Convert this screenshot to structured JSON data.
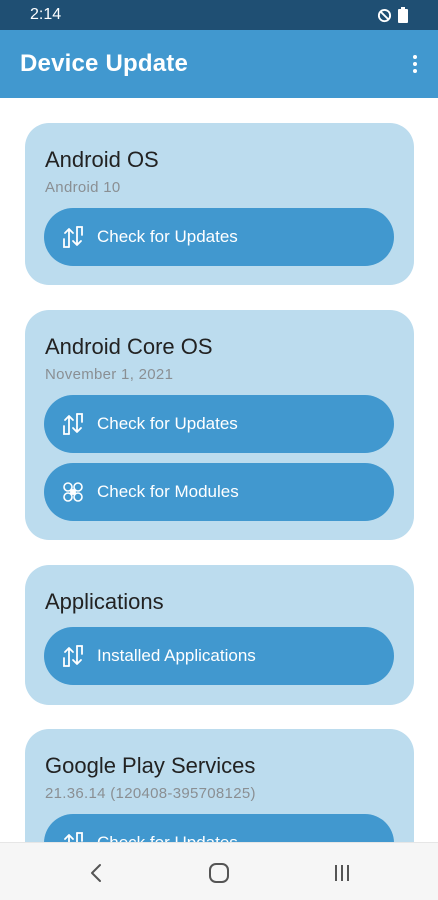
{
  "status_bar": {
    "time": "2:14",
    "icons": [
      "do-not-disturb-icon",
      "battery-icon"
    ]
  },
  "app_bar": {
    "title": "Device Update",
    "menu_icon": "more-vert-icon"
  },
  "cards": [
    {
      "title": "Android OS",
      "subtitle": "Android 10",
      "buttons": [
        {
          "label": "Check for Updates",
          "icon": "sync-arrows-icon"
        }
      ]
    },
    {
      "title": "Android Core OS",
      "subtitle": "November 1, 2021",
      "buttons": [
        {
          "label": "Check for Updates",
          "icon": "sync-arrows-icon"
        },
        {
          "label": "Check for Modules",
          "icon": "modules-icon"
        }
      ]
    },
    {
      "title": "Applications",
      "subtitle": "",
      "buttons": [
        {
          "label": "Installed Applications",
          "icon": "sync-arrows-icon"
        }
      ]
    },
    {
      "title": "Google Play Services",
      "subtitle": "21.36.14 (120408-395708125)",
      "buttons": [
        {
          "label": "Check for Updates",
          "icon": "sync-arrows-icon"
        }
      ]
    }
  ],
  "nav_bar": {
    "icons": [
      "back-icon",
      "home-icon",
      "recents-icon"
    ]
  },
  "colors": {
    "status_bar": "#1f4f73",
    "app_bar": "#4198cf",
    "card": "#bcdcee",
    "button": "#4198cf",
    "nav_bar": "#f6f6f6"
  }
}
